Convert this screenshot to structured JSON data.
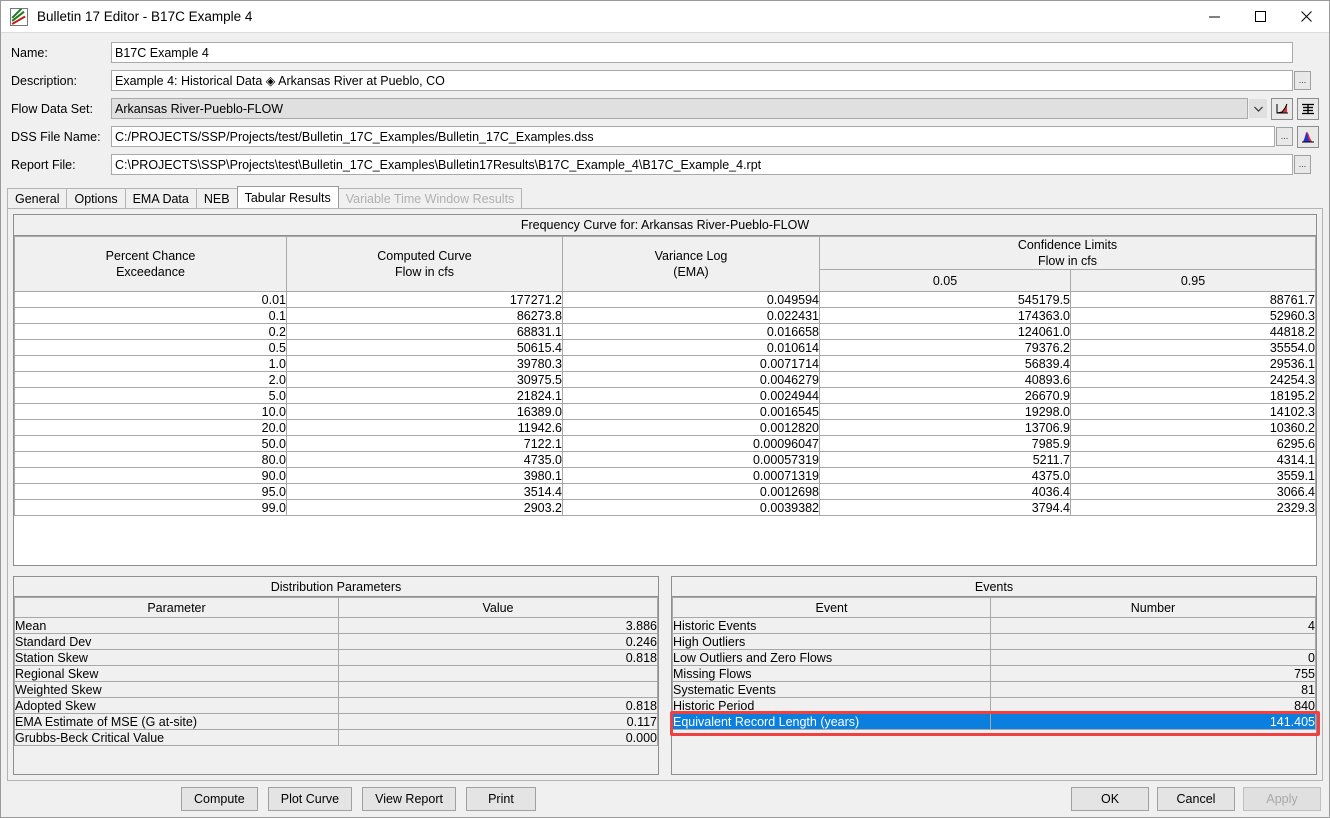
{
  "window": {
    "title": "Bulletin 17 Editor - B17C Example 4",
    "app_icon": "chart-icon",
    "controls": {
      "minimize": "minimize",
      "maximize": "maximize",
      "close": "close"
    }
  },
  "form": {
    "fields": [
      {
        "label": "Name:",
        "value": "B17C Example 4",
        "kind": "text"
      },
      {
        "label": "Description:",
        "value": "Example 4: Historical Data ◈ Arkansas River at Pueblo, CO",
        "kind": "text-ellipsis"
      },
      {
        "label": "Flow Data Set:",
        "value": "Arkansas River-Pueblo-FLOW",
        "kind": "combo"
      },
      {
        "label": "DSS File Name:",
        "value": "C:/PROJECTS/SSP/Projects/test/Bulletin_17C_Examples/Bulletin_17C_Examples.dss",
        "kind": "text-ellipsis"
      },
      {
        "label": "Report File:",
        "value": "C:\\PROJECTS\\SSP\\Projects\\test\\Bulletin_17C_Examples\\Bulletin17Results\\B17C_Example_4\\B17C_Example_4.rpt",
        "kind": "text-ellipsis"
      }
    ],
    "ellipsis_label": "...",
    "side_icons": [
      {
        "name": "plot-curve-icon"
      },
      {
        "name": "table-view-icon"
      },
      {
        "name": "histogram-icon"
      }
    ]
  },
  "tabs": [
    {
      "label": "General",
      "state": "normal"
    },
    {
      "label": "Options",
      "state": "normal"
    },
    {
      "label": "EMA Data",
      "state": "normal"
    },
    {
      "label": "NEB",
      "state": "normal"
    },
    {
      "label": "Tabular Results",
      "state": "active"
    },
    {
      "label": "Variable Time Window Results",
      "state": "disabled"
    }
  ],
  "frequency_curve": {
    "title": "Frequency Curve for: Arkansas River-Pueblo-FLOW",
    "headers": {
      "percent_chance": "Percent Chance\nExceedance",
      "percent_chance_l1": "Percent Chance",
      "percent_chance_l2": "Exceedance",
      "computed_l1": "Computed Curve",
      "computed_l2": "Flow in cfs",
      "variance_l1": "Variance Log",
      "variance_l2": "(EMA)",
      "confidence_l1": "Confidence Limits",
      "confidence_l2": "Flow in cfs",
      "conf_low": "0.05",
      "conf_high": "0.95"
    },
    "rows": [
      {
        "pct": "0.01",
        "computed": "177271.2",
        "variance": "0.049594",
        "low": "545179.5",
        "high": "88761.7"
      },
      {
        "pct": "0.1",
        "computed": "86273.8",
        "variance": "0.022431",
        "low": "174363.0",
        "high": "52960.3"
      },
      {
        "pct": "0.2",
        "computed": "68831.1",
        "variance": "0.016658",
        "low": "124061.0",
        "high": "44818.2"
      },
      {
        "pct": "0.5",
        "computed": "50615.4",
        "variance": "0.010614",
        "low": "79376.2",
        "high": "35554.0"
      },
      {
        "pct": "1.0",
        "computed": "39780.3",
        "variance": "0.0071714",
        "low": "56839.4",
        "high": "29536.1"
      },
      {
        "pct": "2.0",
        "computed": "30975.5",
        "variance": "0.0046279",
        "low": "40893.6",
        "high": "24254.3"
      },
      {
        "pct": "5.0",
        "computed": "21824.1",
        "variance": "0.0024944",
        "low": "26670.9",
        "high": "18195.2"
      },
      {
        "pct": "10.0",
        "computed": "16389.0",
        "variance": "0.0016545",
        "low": "19298.0",
        "high": "14102.3"
      },
      {
        "pct": "20.0",
        "computed": "11942.6",
        "variance": "0.0012820",
        "low": "13706.9",
        "high": "10360.2"
      },
      {
        "pct": "50.0",
        "computed": "7122.1",
        "variance": "0.00096047",
        "low": "7985.9",
        "high": "6295.6"
      },
      {
        "pct": "80.0",
        "computed": "4735.0",
        "variance": "0.00057319",
        "low": "5211.7",
        "high": "4314.1"
      },
      {
        "pct": "90.0",
        "computed": "3980.1",
        "variance": "0.00071319",
        "low": "4375.0",
        "high": "3559.1"
      },
      {
        "pct": "95.0",
        "computed": "3514.4",
        "variance": "0.0012698",
        "low": "4036.4",
        "high": "3066.4"
      },
      {
        "pct": "99.0",
        "computed": "2903.2",
        "variance": "0.0039382",
        "low": "3794.4",
        "high": "2329.3"
      }
    ]
  },
  "distribution_parameters": {
    "title": "Distribution Parameters",
    "col_parameter": "Parameter",
    "col_value": "Value",
    "rows": [
      {
        "name": "Mean",
        "value": "3.886"
      },
      {
        "name": "Standard Dev",
        "value": "0.246"
      },
      {
        "name": "Station Skew",
        "value": "0.818"
      },
      {
        "name": "Regional Skew",
        "value": ""
      },
      {
        "name": "Weighted Skew",
        "value": ""
      },
      {
        "name": "Adopted Skew",
        "value": "0.818"
      },
      {
        "name": "EMA Estimate of MSE (G at-site)",
        "value": "0.117"
      },
      {
        "name": "Grubbs-Beck Critical Value",
        "value": "0.000"
      }
    ]
  },
  "events": {
    "title": "Events",
    "col_event": "Event",
    "col_number": "Number",
    "rows": [
      {
        "name": "Historic Events",
        "value": "4",
        "selected": false
      },
      {
        "name": "High Outliers",
        "value": "",
        "selected": false
      },
      {
        "name": "Low Outliers and Zero Flows",
        "value": "0",
        "selected": false
      },
      {
        "name": "Missing Flows",
        "value": "755",
        "selected": false
      },
      {
        "name": "Systematic Events",
        "value": "81",
        "selected": false
      },
      {
        "name": "Historic Period",
        "value": "840",
        "selected": false
      },
      {
        "name": "Equivalent Record Length (years)",
        "value": "141.405",
        "selected": true
      }
    ],
    "highlight_color": "#f04040",
    "selection_color": "#0a7fe0"
  },
  "buttons": {
    "left": [
      {
        "label": "Compute",
        "state": "normal"
      },
      {
        "label": "Plot Curve",
        "state": "normal"
      },
      {
        "label": "View Report",
        "state": "normal"
      },
      {
        "label": "Print",
        "state": "normal"
      }
    ],
    "right": [
      {
        "label": "OK",
        "state": "normal"
      },
      {
        "label": "Cancel",
        "state": "normal"
      },
      {
        "label": "Apply",
        "state": "disabled"
      }
    ]
  }
}
